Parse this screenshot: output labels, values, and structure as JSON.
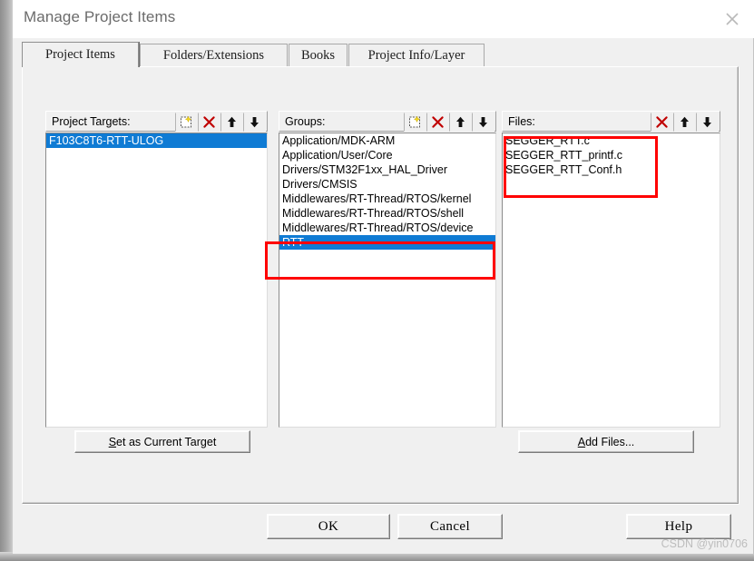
{
  "window": {
    "title": "Manage Project Items",
    "close_icon": "close-icon"
  },
  "tabs": [
    {
      "label": "Project Items",
      "active": true
    },
    {
      "label": "Folders/Extensions",
      "active": false
    },
    {
      "label": "Books",
      "active": false
    },
    {
      "label": "Project Info/Layer",
      "active": false
    }
  ],
  "panels": {
    "targets": {
      "label": "Project Targets:",
      "tools": [
        "new-icon",
        "delete-icon",
        "move-up-icon",
        "move-down-icon"
      ],
      "items": [
        "F103C8T6-RTT-ULOG"
      ],
      "selected_index": 0
    },
    "groups": {
      "label": "Groups:",
      "tools": [
        "new-icon",
        "delete-icon",
        "move-up-icon",
        "move-down-icon"
      ],
      "items": [
        "Application/MDK-ARM",
        "Application/User/Core",
        "Drivers/STM32F1xx_HAL_Driver",
        "Drivers/CMSIS",
        "Middlewares/RT-Thread/RTOS/kernel",
        "Middlewares/RT-Thread/RTOS/shell",
        "Middlewares/RT-Thread/RTOS/device",
        "RTT"
      ],
      "selected_index": 7
    },
    "files": {
      "label": "Files:",
      "tools": [
        "delete-icon",
        "move-up-icon",
        "move-down-icon"
      ],
      "items": [
        "SEGGER_RTT.c",
        "SEGGER_RTT_printf.c",
        "SEGGER_RTT_Conf.h"
      ],
      "selected_index": -1
    }
  },
  "actions": {
    "set_current_target": "Set as Current Target",
    "set_current_target_accel": "S",
    "add_files": "Add Files...",
    "add_files_accel": "A"
  },
  "footer": {
    "ok": "OK",
    "cancel": "Cancel",
    "help": "Help"
  },
  "annotations": {
    "highlight_color": "#ff0000",
    "selection_color": "#0f7bd4"
  },
  "watermark": "CSDN @yin0706"
}
